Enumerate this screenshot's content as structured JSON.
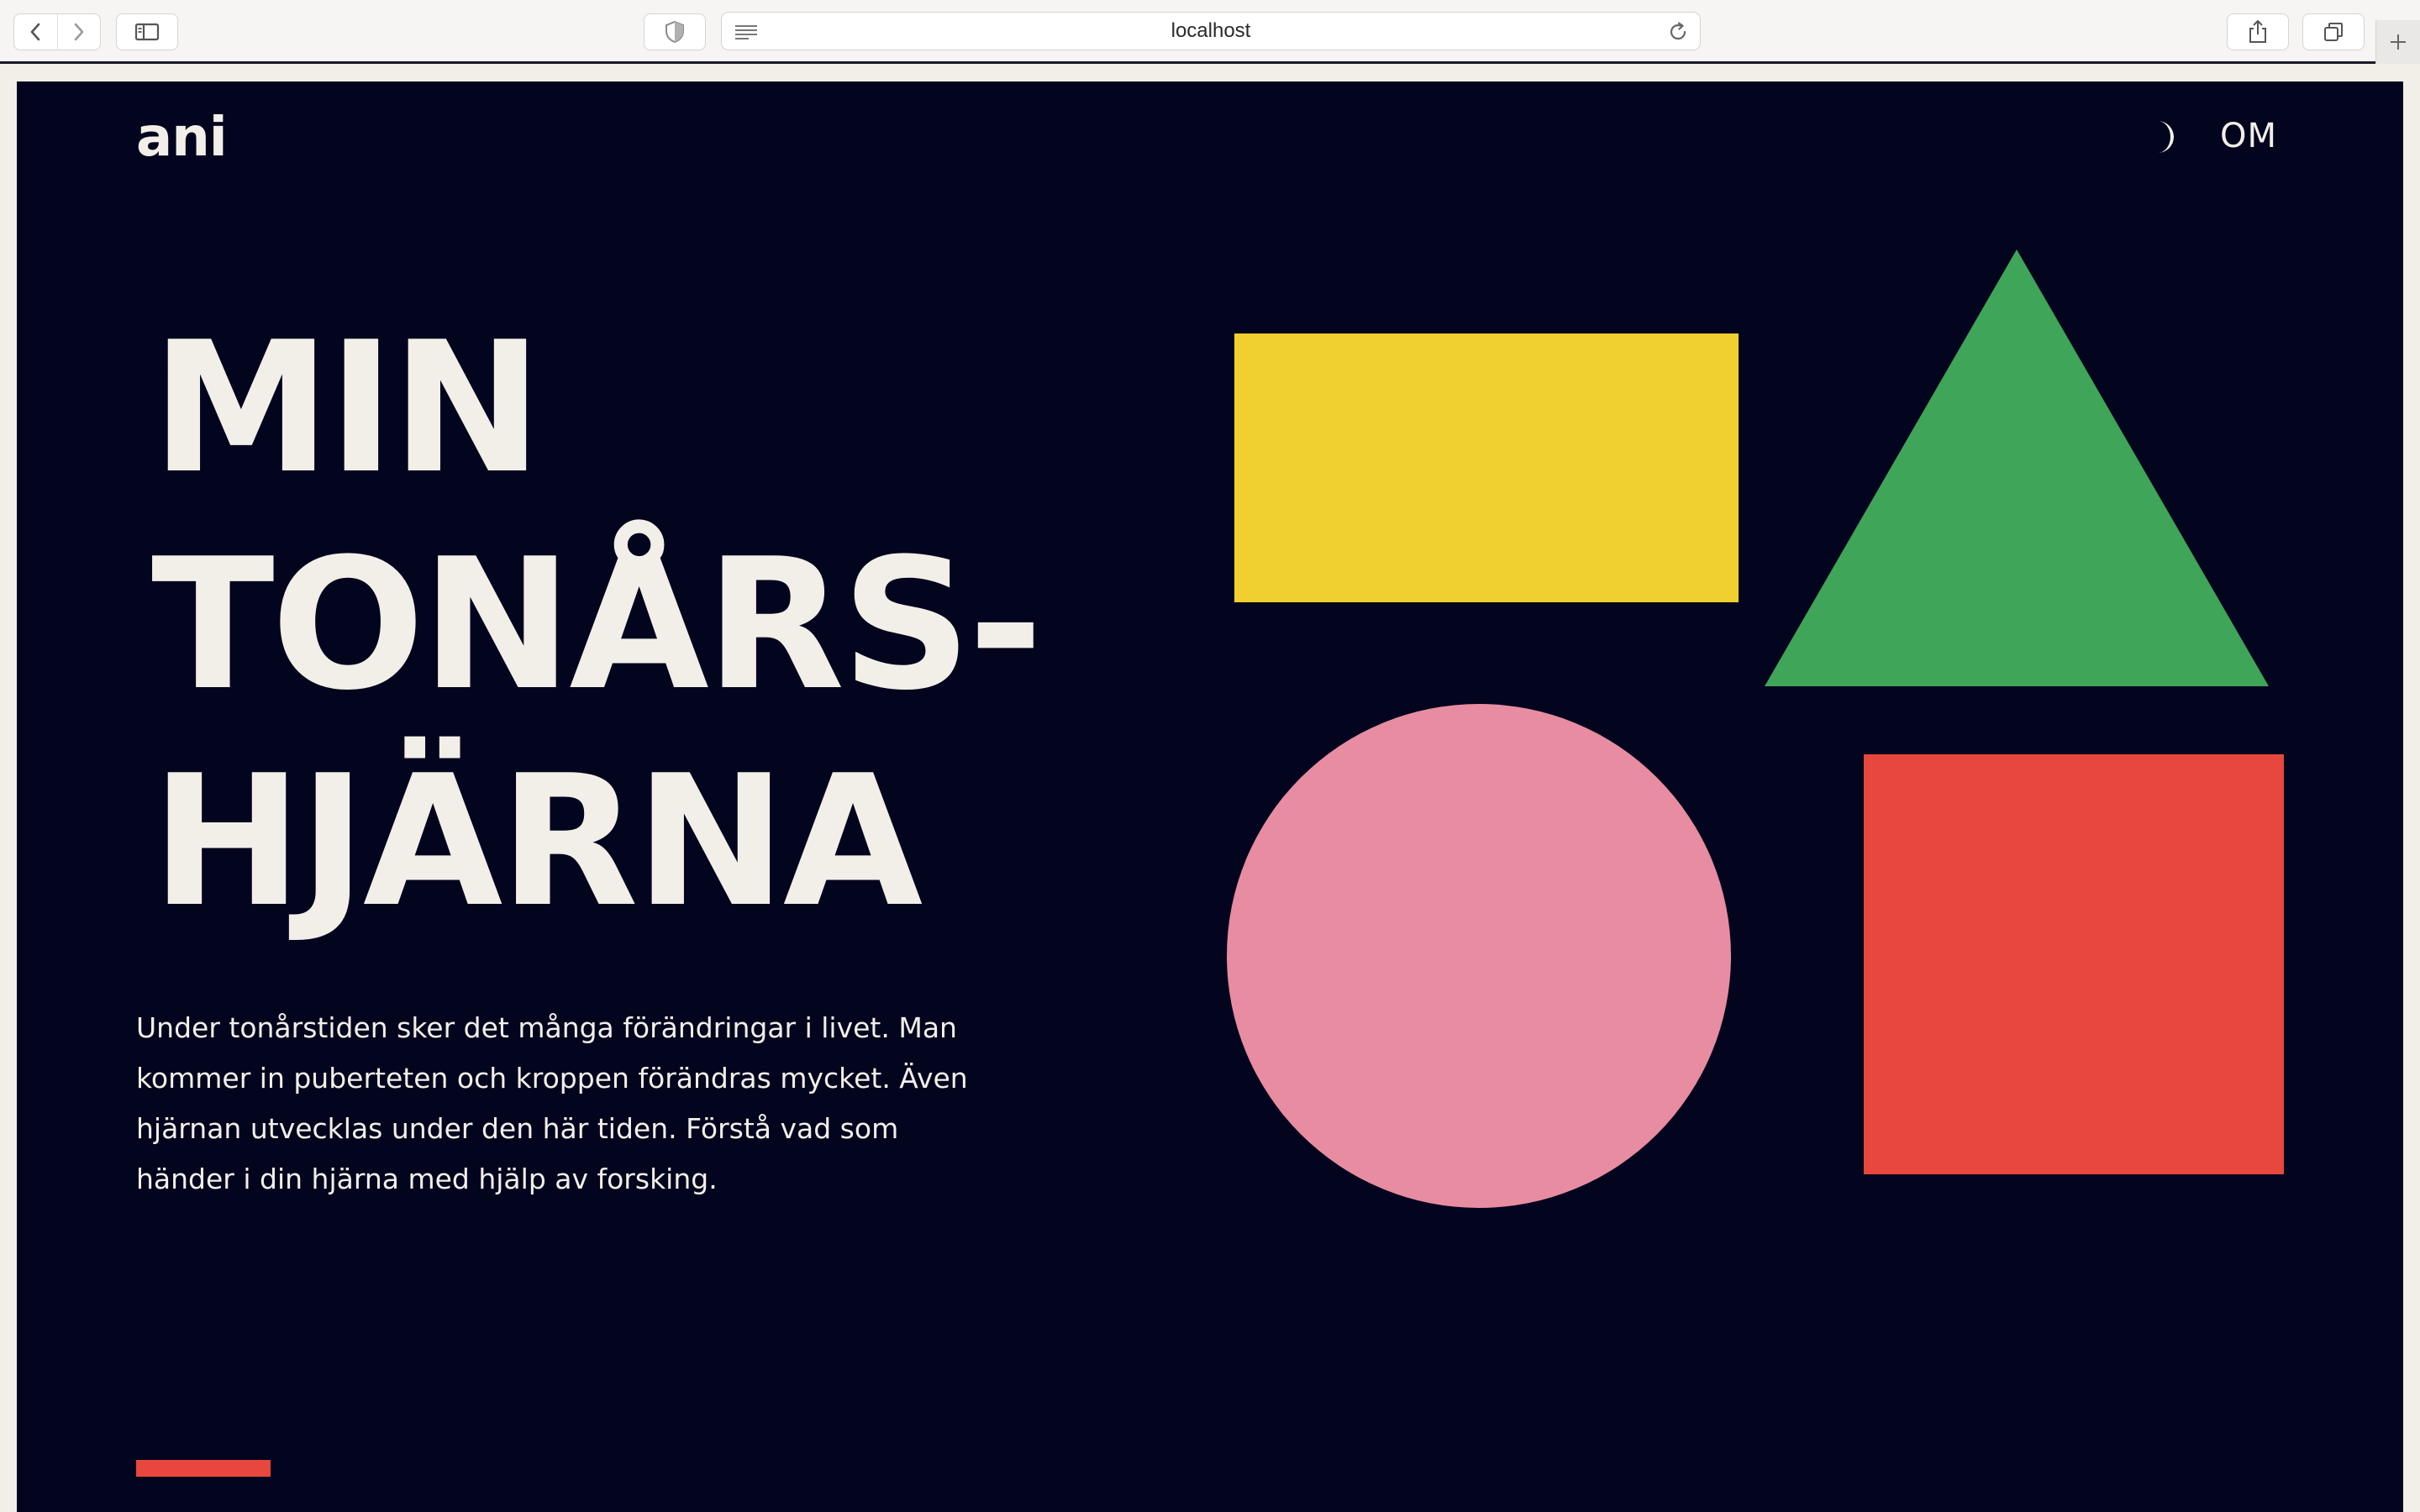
{
  "browser": {
    "url": "localhost"
  },
  "nav": {
    "logo": "ani",
    "about_link": "OM"
  },
  "hero": {
    "headline_lines": [
      "MIN",
      "TONÅRS-",
      "HJÄRNA"
    ],
    "intro": "Under tonårstiden sker det många förändringar i livet. Man kommer in puberteten och kroppen förändras mycket. Även hjärnan utvecklas under den här tiden. Förstå vad som händer i din hjärna med hjälp av forsking."
  },
  "colors": {
    "background": "#03041e",
    "text": "#f2efe9",
    "yellow": "#f0d02e",
    "green": "#3fa558",
    "pink": "#e88ca2",
    "red": "#e8473d"
  },
  "icons": {
    "theme_toggle": "moon-icon",
    "back": "chevron-left-icon",
    "forward": "chevron-right-icon",
    "sidebar": "sidebar-icon",
    "privacy": "shield-icon",
    "reader": "reader-lines-icon",
    "reload": "reload-icon",
    "share": "share-icon",
    "tabs": "tabs-overview-icon",
    "new_tab": "plus-icon"
  }
}
